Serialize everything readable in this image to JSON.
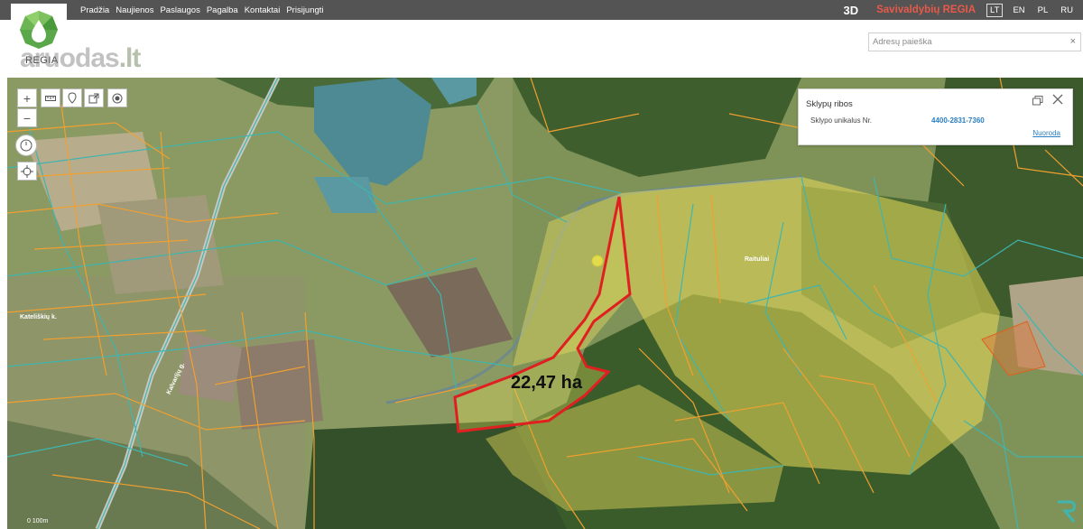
{
  "nav": {
    "items": [
      "Pradžia",
      "Naujienos",
      "Paslaugos",
      "Pagalba",
      "Kontaktai",
      "Prisijungti"
    ]
  },
  "right_nav": {
    "three_d": "3D",
    "brand": "Savivaldybių REGIA",
    "languages": [
      "LT",
      "EN",
      "PL",
      "RU"
    ],
    "active_language": "LT"
  },
  "logo": {
    "label": "REGIA"
  },
  "watermark": {
    "text": "aruodas",
    "suffix": ".lt"
  },
  "search": {
    "placeholder": "Adresų paieška",
    "close": "×"
  },
  "tools": {
    "zoom_in": "+",
    "zoom_out": "−"
  },
  "popup": {
    "title": "Sklypų ribos",
    "label": "Sklypo unikalus Nr.",
    "value": "4400-2831-7360",
    "link": "Nuoroda"
  },
  "map": {
    "area_label": "22,47 ha",
    "place_label": "Kateliškių k.",
    "village_label": "Raituliai",
    "road_label": "Kalvarijų g.",
    "scale_label": "0   100m"
  },
  "colors": {
    "topbar": "#545454",
    "brand": "#e8594a",
    "parcel_orange": "#f0a030",
    "parcel_teal": "#3fb5b0",
    "selection_red": "#e02020",
    "link": "#2b7fc2"
  }
}
